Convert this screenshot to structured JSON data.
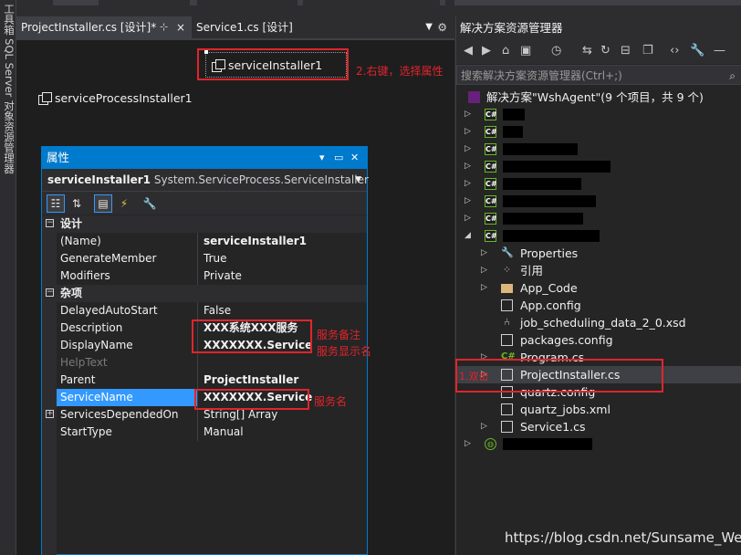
{
  "left_strip": {
    "label": "工具箱  SQL Server 对象资源管理器"
  },
  "doc_tabs": [
    {
      "label": "ProjectInstaller.cs [设计]*",
      "pin": "⊹",
      "close": "×"
    },
    {
      "label": "Service1.cs [设计]"
    }
  ],
  "designer": {
    "components": [
      "serviceInstaller1",
      "serviceProcessInstaller1"
    ],
    "annotation_right_click": "2.右键，选择属性"
  },
  "properties": {
    "title": "属性",
    "title_controls": [
      "▾",
      "▭",
      "✕"
    ],
    "target_name": "serviceInstaller1",
    "target_type": "System.ServiceProcess.ServiceInstaller",
    "categories": [
      {
        "name": "设计",
        "rows": [
          {
            "name": "(Name)",
            "value": "serviceInstaller1",
            "bold": true
          },
          {
            "name": "GenerateMember",
            "value": "True"
          },
          {
            "name": "Modifiers",
            "value": "Private"
          }
        ]
      },
      {
        "name": "杂项",
        "rows": [
          {
            "name": "DelayedAutoStart",
            "value": "False"
          },
          {
            "name": "Description",
            "value": "XXX系统XXX服务",
            "bold": true
          },
          {
            "name": "DisplayName",
            "value": "XXXXXXX.Service",
            "bold": true
          },
          {
            "name": "HelpText",
            "value": ""
          },
          {
            "name": "Parent",
            "value": "ProjectInstaller",
            "bold": true
          },
          {
            "name": "ServiceName",
            "value": "XXXXXXX.Service",
            "bold": true
          },
          {
            "name": "ServicesDependedOn",
            "value": "String[] Array"
          },
          {
            "name": "StartType",
            "value": "Manual"
          }
        ]
      }
    ],
    "annotations": {
      "description": "服务备注",
      "display_name": "服务显示名",
      "service_name": "服务名"
    }
  },
  "solution_explorer": {
    "title": "解决方案资源管理器",
    "search_placeholder": "搜索解决方案资源管理器(Ctrl+;)",
    "solution_label": "解决方案\"WshAgent\"(9 个项目，共 9 个)",
    "project_badge": "C#",
    "children": [
      "Properties",
      "引用",
      "App_Code",
      "App.config",
      "job_scheduling_data_2_0.xsd",
      "packages.config",
      "Program.cs",
      "ProjectInstaller.cs",
      "quartz.config",
      "quartz_jobs.xml",
      "Service1.cs"
    ],
    "annotation_double_click": "1.双击"
  },
  "watermark": "https://blog.csdn.net/Sunsame_Wei",
  "colors": {
    "accent": "#007acc",
    "annotation": "#e0252b",
    "selection": "#3399ff"
  }
}
